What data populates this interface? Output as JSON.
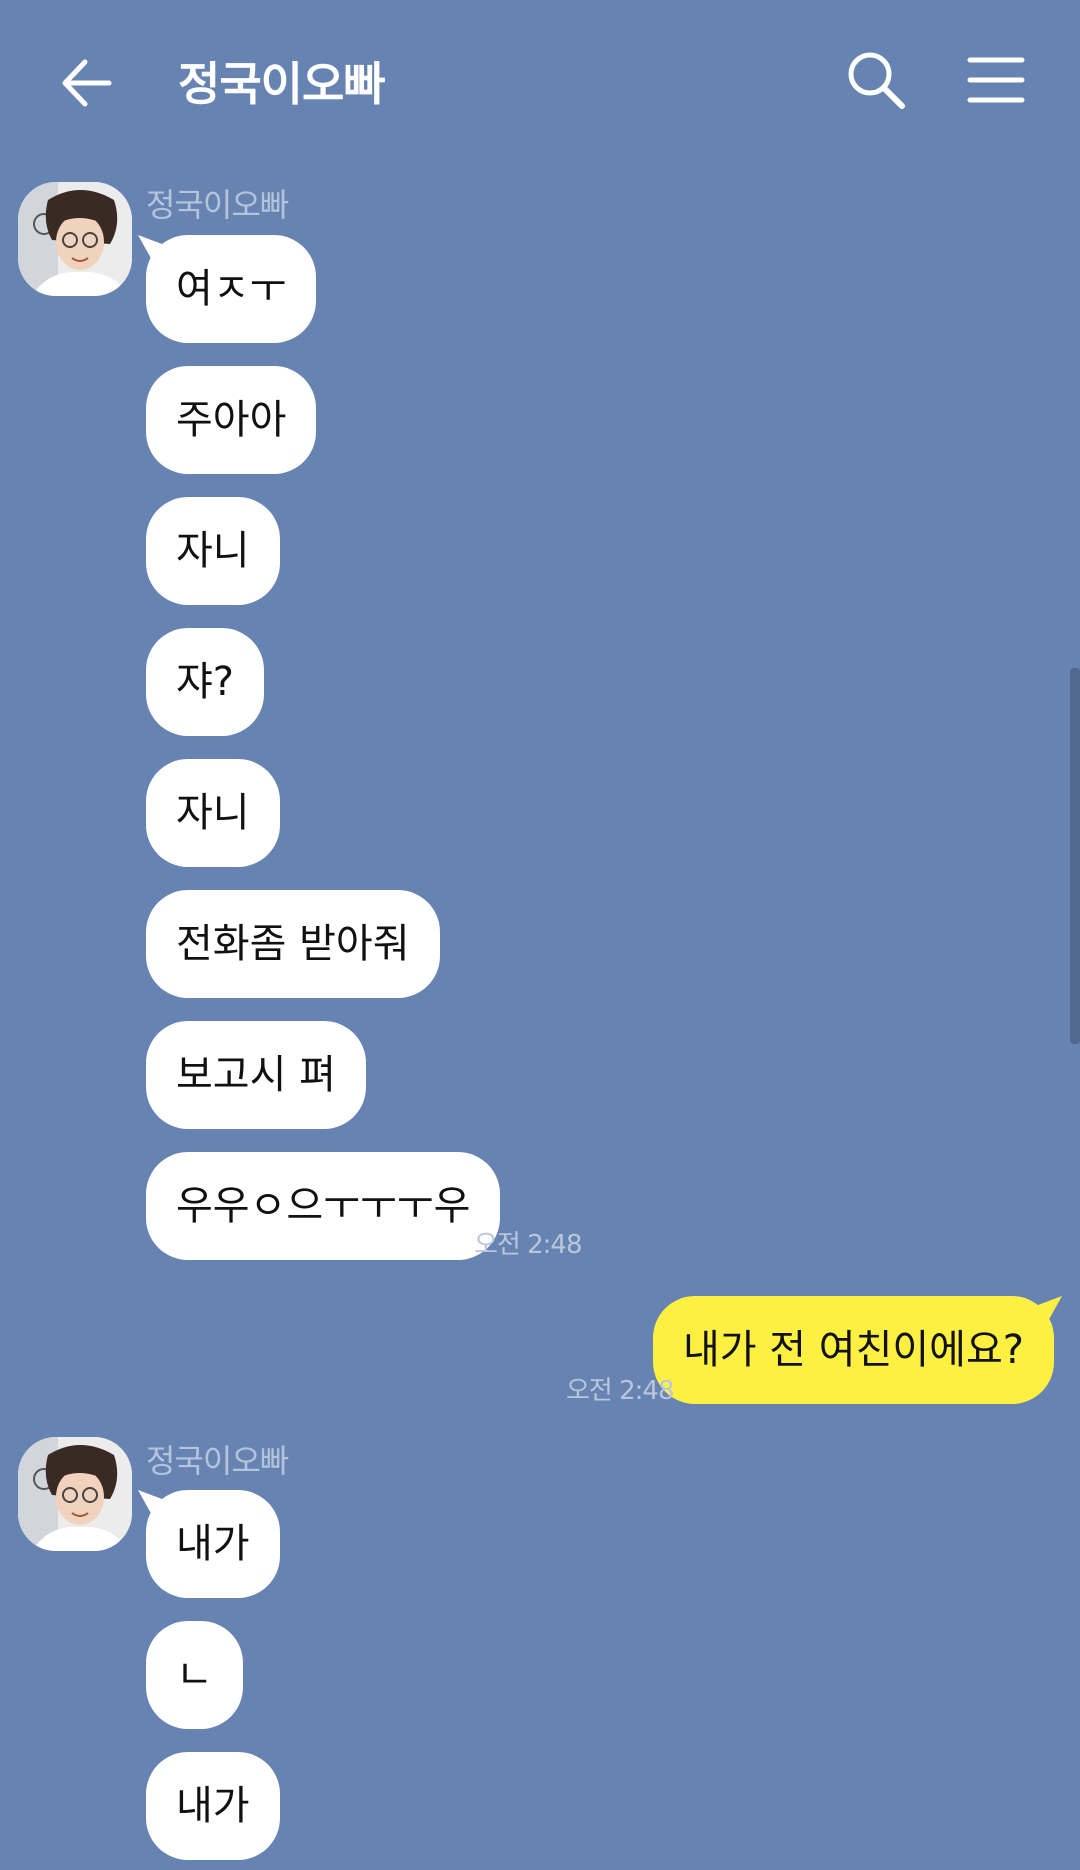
{
  "header": {
    "title": "정국이오빠",
    "back_icon": "arrow-left-icon",
    "search_icon": "search-icon",
    "menu_icon": "hamburger-menu-icon"
  },
  "colors": {
    "background": "#6783b1",
    "incoming_bubble": "#ffffff",
    "outgoing_bubble": "#fef042"
  },
  "group1": {
    "sender": "정국이오빠",
    "messages": [
      "여ㅈㅜ",
      "주아아",
      "자니",
      "쟈?",
      "자니",
      "전화좀 받아줘",
      "보고시 펴",
      "우우ㅇ으ㅜㅜㅜ우"
    ],
    "time": "오전 2:48"
  },
  "mine": {
    "message": "내가 전 여친이에요?",
    "time": "오전 2:48"
  },
  "group2": {
    "sender": "정국이오빠",
    "messages": [
      "내가",
      "ㄴ",
      "내가"
    ]
  }
}
